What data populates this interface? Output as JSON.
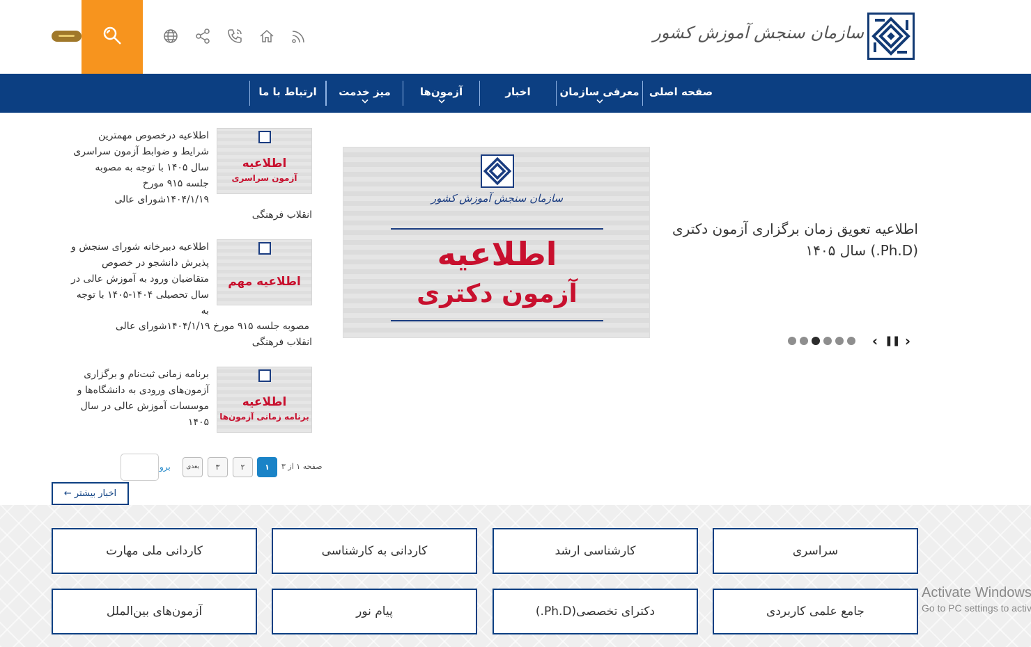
{
  "header": {
    "org_name": "سازمان سنجش آموزش کشور"
  },
  "nav": {
    "items": [
      {
        "label": "صفحه اصلی",
        "has_dropdown": false
      },
      {
        "label": "معرفی سازمان",
        "has_dropdown": true
      },
      {
        "label": "اخبار",
        "has_dropdown": false
      },
      {
        "label": "آزمون‌ها",
        "has_dropdown": true
      },
      {
        "label": "میز خدمت",
        "has_dropdown": true
      },
      {
        "label": "ارتباط با ما",
        "has_dropdown": false
      }
    ]
  },
  "icons": [
    "search-icon",
    "globe-icon",
    "share-icon",
    "phone-icon",
    "home-icon",
    "rss-icon",
    "language-toggle"
  ],
  "hero": {
    "title": "اطلاعیه تعویق زمان برگزاری آزمون دکتری (Ph.D.) سال ۱۴۰۵",
    "image": {
      "org_name": "سازمان سنجش آموزش کشور",
      "heading": "اطلاعیه",
      "subheading": "آزمون دکتری"
    },
    "slides_count": 6,
    "active_slide": 3
  },
  "news": [
    {
      "text": "اطلاعیه درخصوص مهمترین شرایط و ضوابط آزمون سراسری سال ۱۴۰۵ با توجه به مصوبه جلسه ۹۱۵ مورخ ۱۴۰۴/۱/۱۹شورای عالی",
      "tail": "انقلاب فرهنگی",
      "thumb_line1": "اطلاعیه",
      "thumb_line2": "آزمون سراسری"
    },
    {
      "text": "اطلاعیه دبیرخانه شورای سنجش و پذیرش دانشجو در خصوص متقاضیان ورود به آموزش عالی در سال تحصیلی ۱۴۰۴-۱۴۰۵  با توجه به",
      "tail1": "مصوبه جلسه ۹۱۵ مورخ ۱۴۰۴/۱/۱۹شورای عالی",
      "tail": "انقلاب فرهنگی",
      "thumb_line1": "اطلاعیه مهم",
      "thumb_line2": ""
    },
    {
      "text": "برنامه زمانی ثبت‌نام و برگزاری آزمون‌های ورودی به دانشگاه‌ها و موسسات آموزش عالی در سال ۱۴۰۵",
      "thumb_line1": "اطلاعیه",
      "thumb_line2": "برنامه زمانی آزمون‌ها"
    }
  ],
  "pagination": {
    "status": "صفحه ۱ از ۳",
    "pages": [
      "۱",
      "۲",
      "۳"
    ],
    "current": "۱",
    "next_label": "بعدی",
    "go_label": "برو"
  },
  "more_news_label": "اخبار بیشتر ←",
  "categories": [
    "سراسری",
    "کارشناسی ارشد",
    "کاردانی به کارشناسی",
    "کاردانی ملی مهارت",
    "جامع علمی کاربردی",
    "دکترای تخصصی(Ph.D.)",
    "پیام نور",
    "آزمون‌های بین‌الملل"
  ],
  "watermark": {
    "line1": "Activate Windows",
    "line2": "Go to PC settings to activate Windows."
  },
  "colors": {
    "nav_bg": "#0c3f82",
    "search_bg": "#f7941e",
    "accent_blue": "#1a83c7",
    "banner_red": "#c8102e"
  }
}
